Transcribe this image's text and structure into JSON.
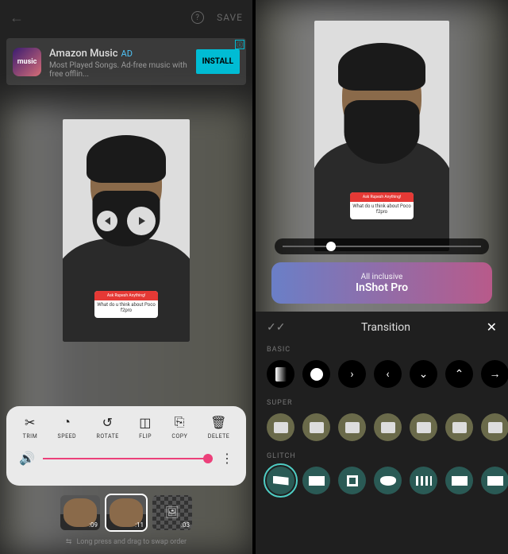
{
  "left": {
    "topbar": {
      "save": "SAVE"
    },
    "ad": {
      "icon_text": "music",
      "title": "Amazon Music",
      "tag": "AD",
      "subtitle": "Most Played Songs. Ad-free music with free offlin...",
      "button": "INSTALL"
    },
    "sticker": {
      "header": "Ask Rupesh Anything!",
      "body": "What do u think about Poco f2pro"
    },
    "edit_items": [
      {
        "label": "TRIM"
      },
      {
        "label": "SPEED"
      },
      {
        "label": "ROTATE"
      },
      {
        "label": "FLIP"
      },
      {
        "label": "COPY"
      },
      {
        "label": "DELETE"
      }
    ],
    "clips": [
      {
        "duration": ":09"
      },
      {
        "duration": ":11"
      },
      {
        "duration": ":03"
      }
    ],
    "hint": "Long press and drag to swap order"
  },
  "right": {
    "sticker": {
      "header": "Ask Rupesh Anything!",
      "body": "What do u think about Poco f2pro"
    },
    "pro": {
      "small": "All inclusive",
      "big": "InShot Pro"
    },
    "transition": {
      "title": "Transition",
      "sections": [
        "BASIC",
        "SUPER",
        "GLITCH"
      ]
    }
  }
}
